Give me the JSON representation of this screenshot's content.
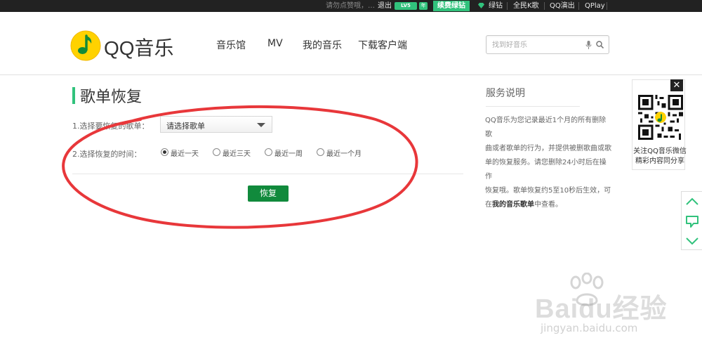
{
  "topbar": {
    "hint": "请勿点赞哦，…",
    "logout": "退出",
    "level_badge": "LV5",
    "year_badge": "年",
    "renew": "续费绿钻",
    "green_diamond": "绿钻",
    "national_karaoke": "全民K歌",
    "qq_live": "QQ演出",
    "qplay": "QPlay"
  },
  "header": {
    "logo_text": "QQ音乐",
    "nav": [
      "音乐馆",
      "MV",
      "我的音乐",
      "下载客户端"
    ],
    "search": {
      "placeholder": "找到好音乐"
    }
  },
  "form": {
    "title": "歌单恢复",
    "step1_label": "1.选择要恢复的歌单：",
    "select_value": "请选择歌单",
    "step2_label": "2.选择恢复的时间：",
    "time_options": [
      {
        "label": "最近一天",
        "checked": true
      },
      {
        "label": "最近三天",
        "checked": false
      },
      {
        "label": "最近一周",
        "checked": false
      },
      {
        "label": "最近一个月",
        "checked": false
      }
    ],
    "submit": "恢复"
  },
  "service": {
    "title": "服务说明",
    "desc_lines": [
      "QQ音乐为您记录最近1个月的所有删除歌",
      "曲或者歌单的行为，并提供被删歌曲或歌",
      "单的恢复服务。请您删除24小时后在操作",
      "恢复哦。歌单恢复约5至10秒后生效，可"
    ],
    "desc_prefix": "在",
    "desc_link": "我的音乐歌单",
    "desc_suffix": "中查看。"
  },
  "qr": {
    "caption_line1": "关注QQ音乐微信",
    "caption_line2": "精彩内容同分享"
  },
  "watermark": {
    "brand": "Baidu经验",
    "url": "jingyan.baidu.com"
  },
  "colors": {
    "accent_green": "#31c27c",
    "button_green": "#118a3c",
    "annotation_red": "#e8373a"
  }
}
